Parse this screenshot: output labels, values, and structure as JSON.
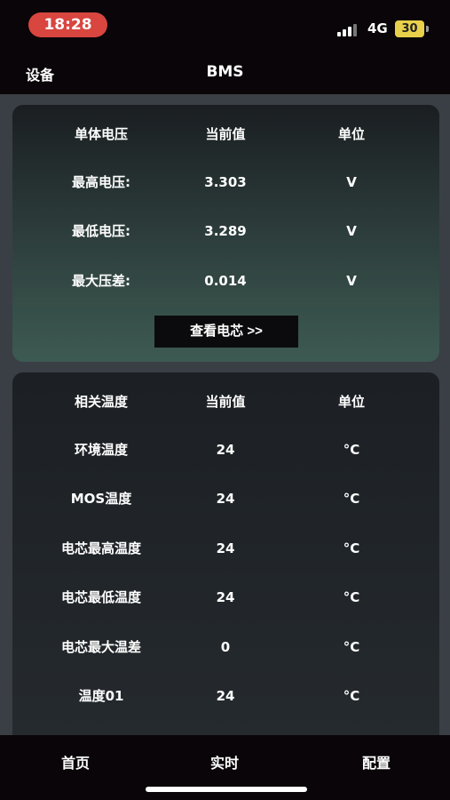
{
  "status_bar": {
    "time": "18:28",
    "network": "4G",
    "battery": "30",
    "signal_icon": "signal-bars-icon",
    "battery_color": "#e8d04a",
    "time_pill_color": "#d9453f"
  },
  "nav": {
    "back_label": "设备",
    "title": "BMS"
  },
  "voltage_section": {
    "headers": [
      "单体电压",
      "当前值",
      "单位"
    ],
    "rows": [
      {
        "label": "最高电压:",
        "value": "3.303",
        "unit": "V"
      },
      {
        "label": "最低电压:",
        "value": "3.289",
        "unit": "V"
      },
      {
        "label": "最大压差:",
        "value": "0.014",
        "unit": "V"
      }
    ],
    "button_label": "查看电芯 >>"
  },
  "temperature_section": {
    "headers": [
      "相关温度",
      "当前值",
      "单位"
    ],
    "rows": [
      {
        "label": "环境温度",
        "value": "24",
        "unit": "°C"
      },
      {
        "label": "MOS温度",
        "value": "24",
        "unit": "°C"
      },
      {
        "label": "电芯最高温度",
        "value": "24",
        "unit": "°C"
      },
      {
        "label": "电芯最低温度",
        "value": "24",
        "unit": "°C"
      },
      {
        "label": "电芯最大温差",
        "value": "0",
        "unit": "°C"
      },
      {
        "label": "温度01",
        "value": "24",
        "unit": "°C"
      }
    ]
  },
  "tab_bar": {
    "items": [
      "首页",
      "实时",
      "配置"
    ]
  }
}
